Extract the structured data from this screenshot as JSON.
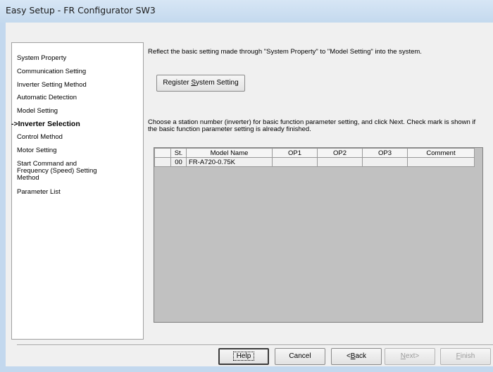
{
  "window": {
    "title": "Easy Setup - FR Configurator SW3"
  },
  "steps": [
    {
      "label": "System Property",
      "current": false
    },
    {
      "label": "Communication Setting",
      "current": false
    },
    {
      "label": "Inverter Setting Method",
      "current": false
    },
    {
      "label": "Automatic Detection",
      "current": false
    },
    {
      "label": "Model Setting",
      "current": false
    },
    {
      "label": "->Inverter Selection",
      "current": true
    },
    {
      "label": "Control Method",
      "current": false
    },
    {
      "label": "Motor Setting",
      "current": false
    },
    {
      "label": "Start Command and",
      "label2": "Frequency (Speed) Setting",
      "label3": "Method",
      "current": false
    },
    {
      "label": "Parameter List",
      "current": false
    }
  ],
  "instructions": {
    "reflect": "Reflect the basic setting made through \"System Property\" to \"Model Setting\" into the system.",
    "choose_line1": "Choose a station number (inverter) for basic function parameter setting, and click Next. Check mark is shown if",
    "choose_line2": "the basic function parameter setting is already finished."
  },
  "register_button": {
    "pre": "Register ",
    "key": "S",
    "post": "ystem Setting"
  },
  "grid": {
    "headers": [
      "",
      "St.",
      "Model Name",
      "OP1",
      "OP2",
      "OP3",
      "Comment"
    ],
    "rows": [
      {
        "check": "",
        "st": "00",
        "model": "FR-A720-0.75K",
        "op1": "",
        "op2": "",
        "op3": "",
        "comment": ""
      }
    ]
  },
  "footer": {
    "help": "Help",
    "cancel": "Cancel",
    "back_pre": "<",
    "back_key": "B",
    "back_post": "ack",
    "next_key": "N",
    "next_post": "ext>",
    "finish_key": "F",
    "finish_post": "inish"
  },
  "colors": {
    "window_frame": "#c3d8ee",
    "client_bg": "#f0f0f0",
    "grid_bg": "#c1c1c1"
  }
}
